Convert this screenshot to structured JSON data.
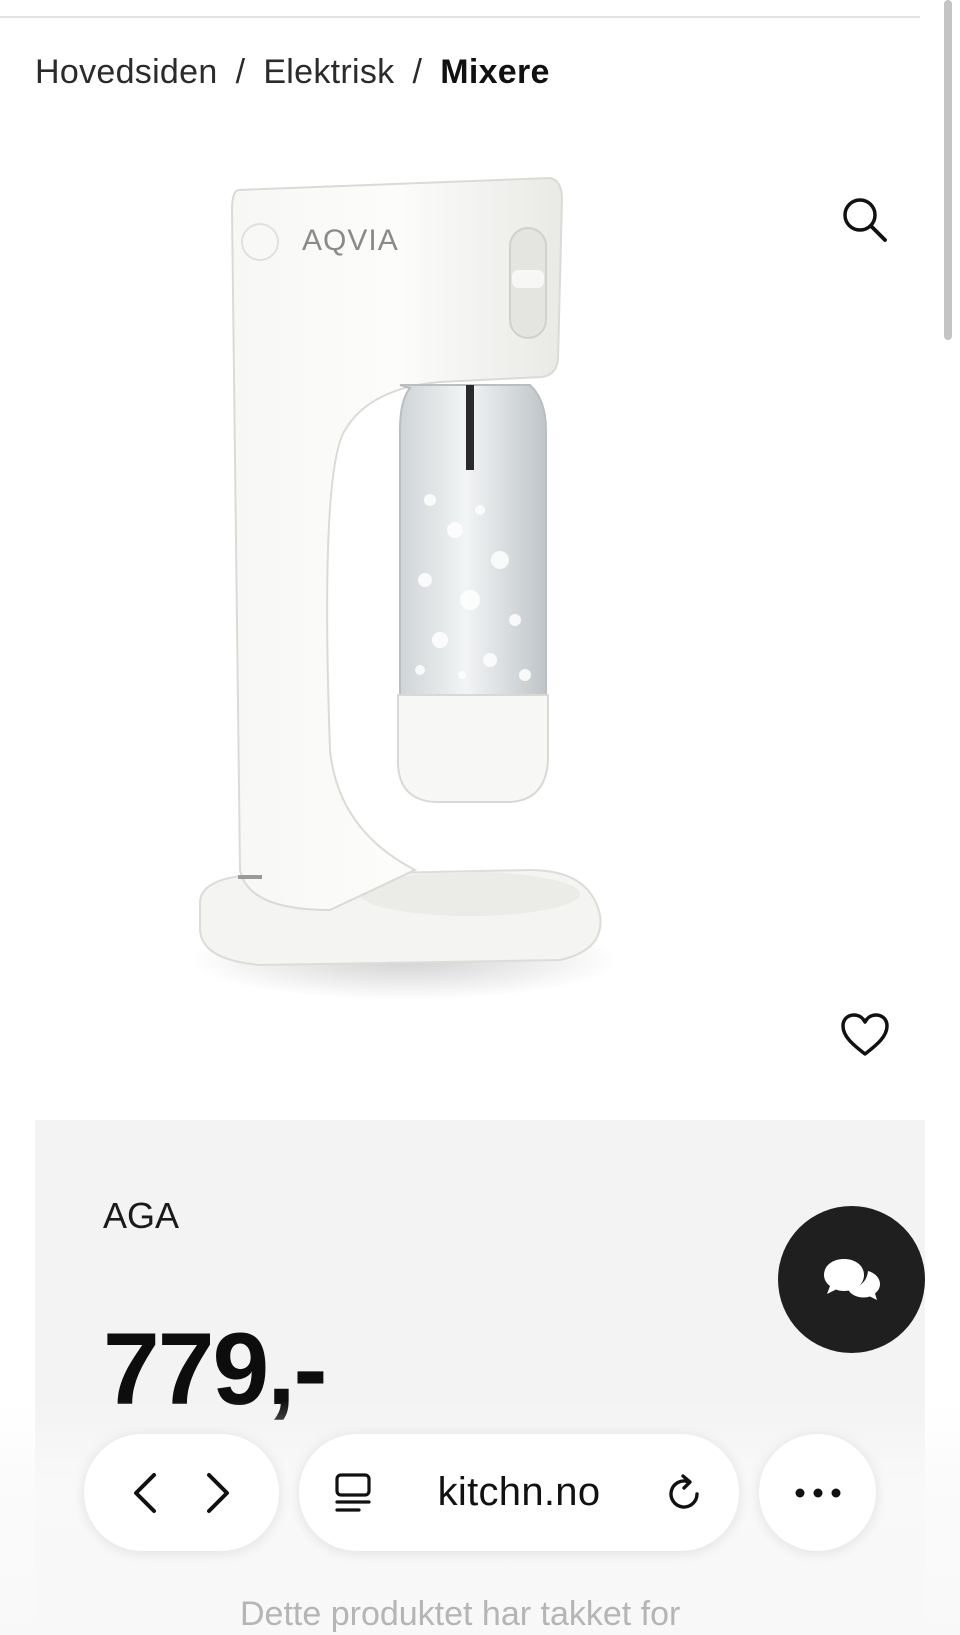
{
  "breadcrumb": {
    "items": [
      "Hovedsiden",
      "Elektrisk"
    ],
    "separator": "/",
    "current": "Mixere"
  },
  "product": {
    "image_alt": "AQVIA",
    "brand": "AGA",
    "price": "779,-",
    "note": "Dette produktet har takket for"
  },
  "icons": {
    "search": "search-icon",
    "favorite": "heart-icon",
    "chat": "chat-bubbles-icon",
    "back": "chevron-left-icon",
    "forward": "chevron-right-icon",
    "reader": "reader-mode-icon",
    "reload": "reload-icon",
    "more": "more-dots-icon"
  },
  "browser": {
    "url": "kitchn.no"
  },
  "colors": {
    "chat_button": "#1f1f1f",
    "panel_bg": "#f3f3f3"
  }
}
